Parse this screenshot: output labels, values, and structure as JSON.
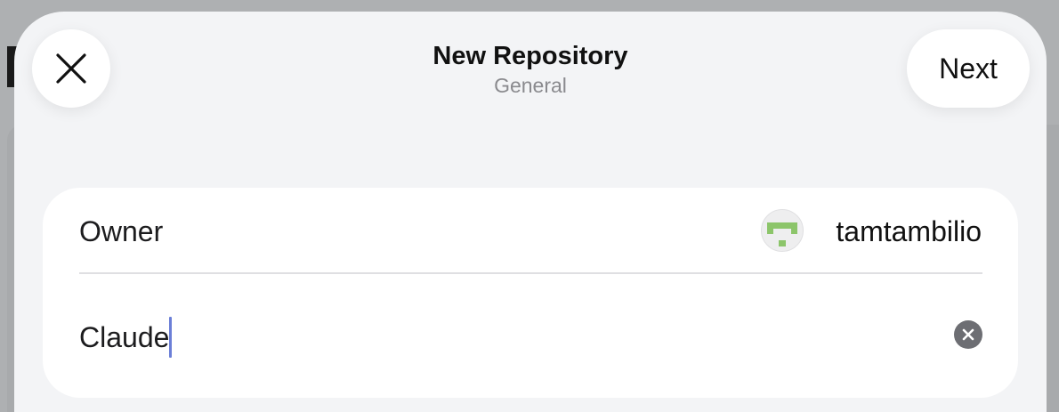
{
  "sheet": {
    "title": "New Repository",
    "subtitle": "General",
    "close_icon": "xmark-icon",
    "next_label": "Next"
  },
  "form": {
    "owner_label": "Owner",
    "owner_value": "tamtambilio",
    "owner_avatar_icon": "identicon-avatar",
    "name_value": "Claude",
    "clear_icon": "xmark-circle-fill-icon"
  },
  "colors": {
    "sheet_bg": "#f3f4f6",
    "card_bg": "#ffffff",
    "caret": "#6b7fd7",
    "avatar_green": "#8cc56a",
    "subtitle_gray": "#8a8a8e"
  }
}
